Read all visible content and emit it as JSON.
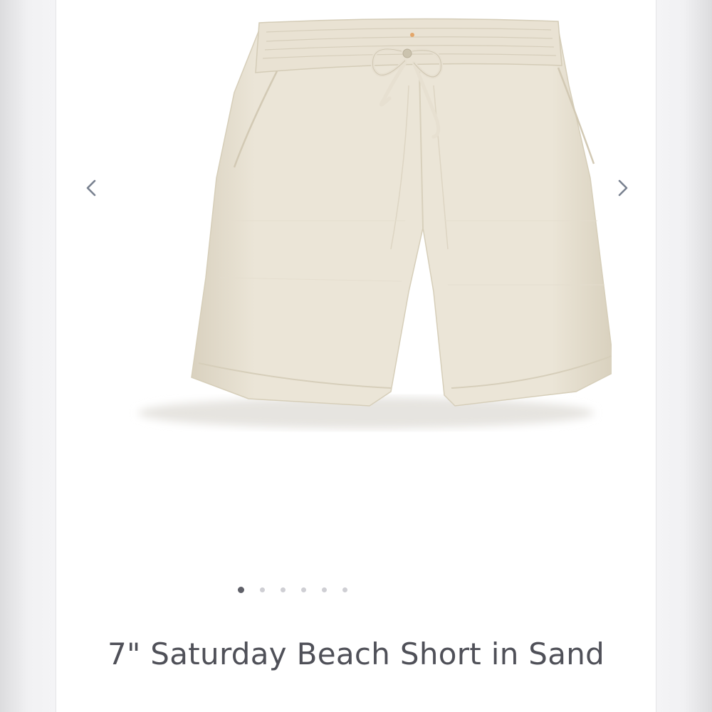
{
  "gallery": {
    "image_alt": "7\" Saturday Beach Short in Sand",
    "prev_icon": "chevron-left-icon",
    "next_icon": "chevron-right-icon",
    "slide_count": 6,
    "active_slide": 1
  },
  "product": {
    "title": "7\" Saturday Beach Short in Sand"
  },
  "colors": {
    "product": "#ece6d8",
    "arrow": "#7a8290",
    "title": "#4f5058",
    "dot_active": "#5f6068",
    "dot_inactive": "#cfcfd4"
  }
}
